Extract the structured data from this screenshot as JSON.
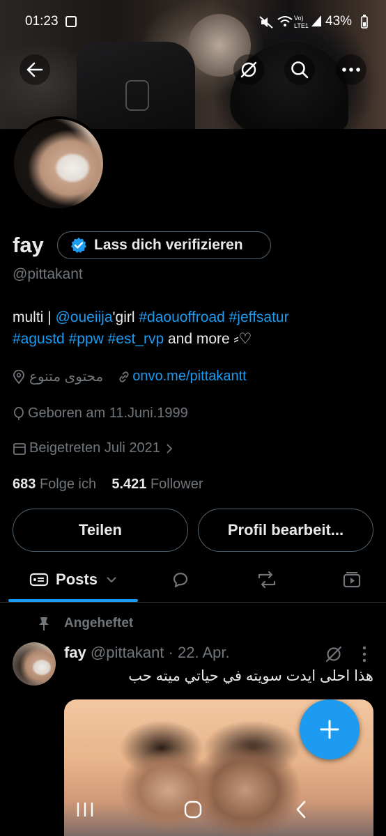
{
  "status_bar": {
    "time": "01:23",
    "battery": "43%"
  },
  "profile": {
    "name": "fay",
    "verify_label": "Lass dich verifizieren",
    "handle": "@pittakant",
    "bio": {
      "prefix": "multi | ",
      "mention": "@oueiija",
      "mid": "'girl ",
      "tag1": "#daouoffroad",
      "tag2": "#jeffsatur",
      "tag3": "#agustd",
      "tag4": "#ppw",
      "tag5": "#est_rvp",
      "suffix": " and more ⸗♡"
    },
    "location": "محتوى متنوع",
    "website": "onvo.me/pittakantt",
    "birthday": "Geboren am 11.Juni.1999",
    "joined": "Beigetreten Juli 2021",
    "following_count": "683",
    "following_label": "Folge ich",
    "followers_count": "5.421",
    "followers_label": "Follower"
  },
  "buttons": {
    "share": "Teilen",
    "edit": "Profil bearbeit..."
  },
  "tabs": {
    "posts": "Posts"
  },
  "pinned_post": {
    "pinned_label": "Angeheftet",
    "author": "fay",
    "handle": "@pittakant",
    "date": "· 22. Apr.",
    "text": "هذا احلى ايدت سويته في حياتي ميته حب"
  },
  "colors": {
    "accent": "#1d9bf0",
    "background": "#000000",
    "muted": "#71767b",
    "text": "#e7e9ea"
  }
}
